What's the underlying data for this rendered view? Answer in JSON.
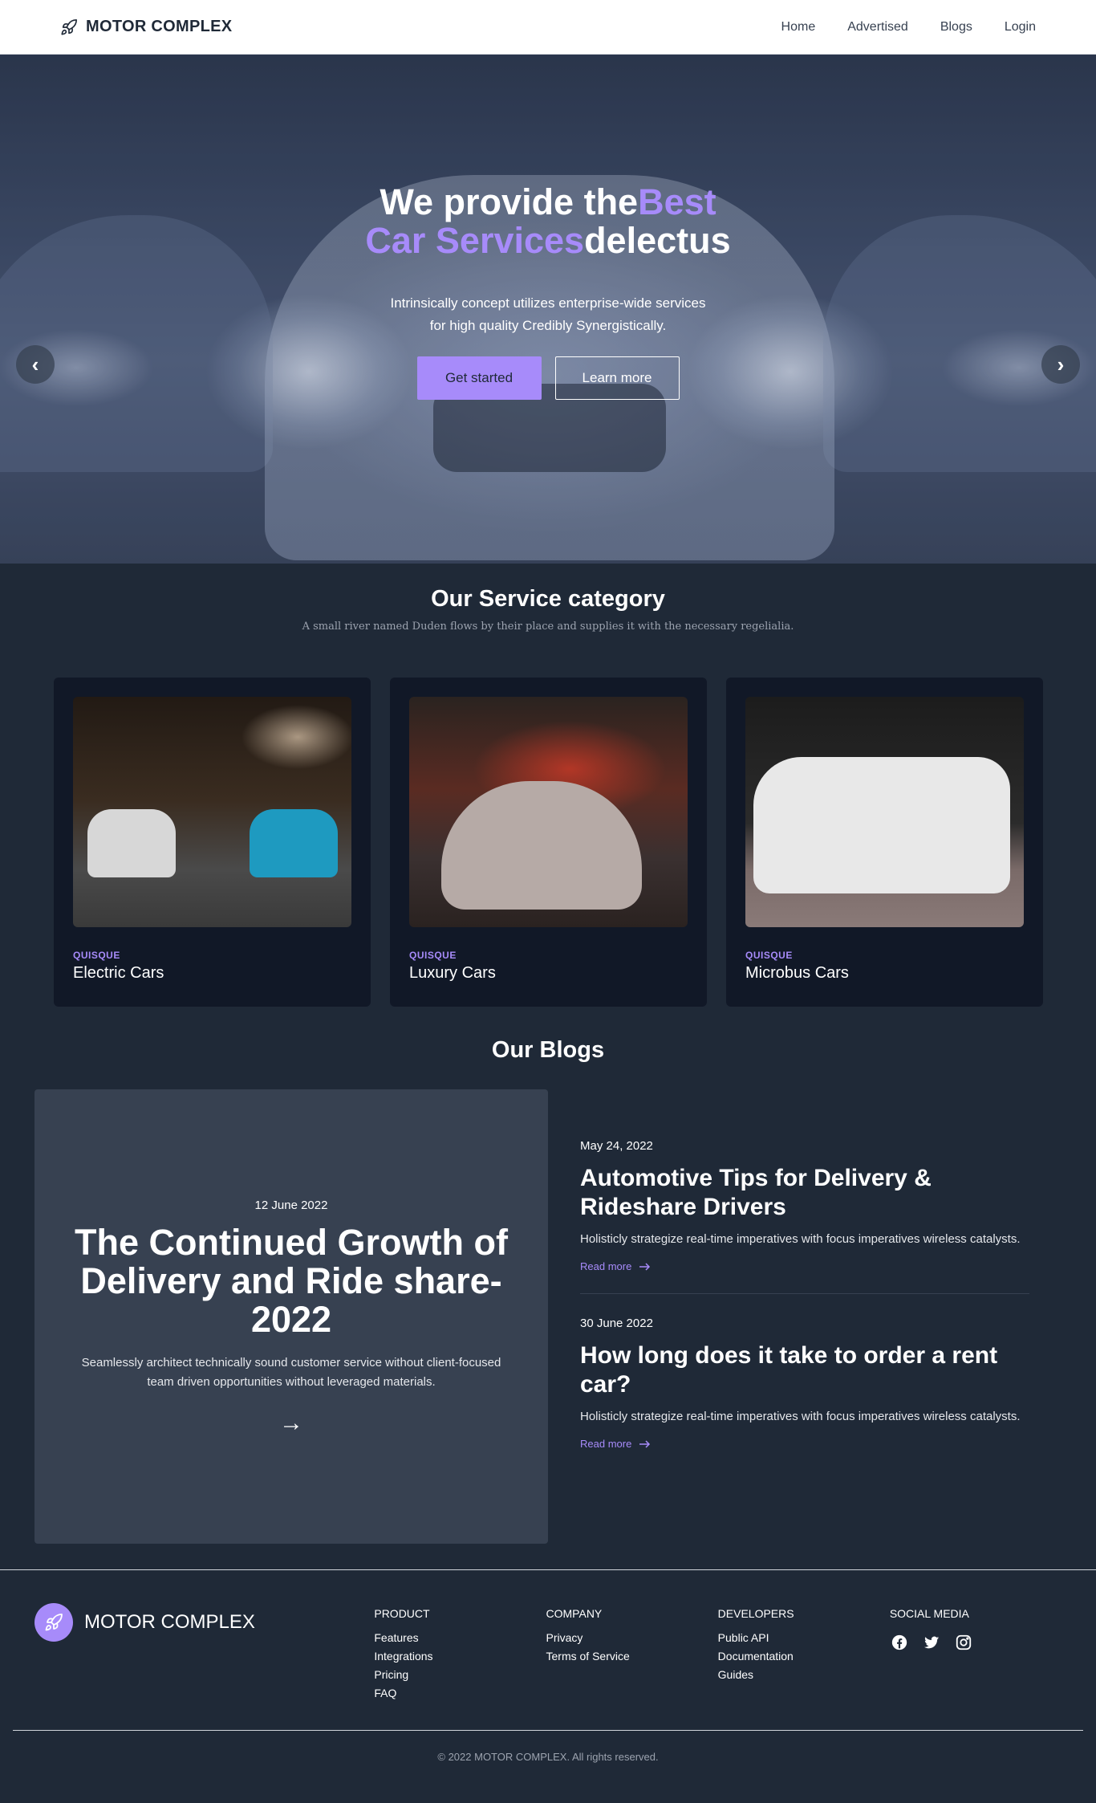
{
  "nav": {
    "brand": "MOTOR COMPLEX",
    "links": [
      "Home",
      "Advertised",
      "Blogs",
      "Login"
    ]
  },
  "hero": {
    "title_prefix": "We provide the",
    "title_accent": "Best Car Services",
    "title_suffix": "delectus",
    "description": "Intrinsically concept utilizes enterprise-wide services for high quality Credibly Synergistically.",
    "primary_button": "Get started",
    "secondary_button": "Learn more",
    "prev_label": "‹",
    "next_label": "›"
  },
  "service": {
    "title": "Our Service category",
    "subtitle": "A small river named Duden flows by their place and supplies it with the necessary regelialia.",
    "cards": [
      {
        "tag": "QUISQUE",
        "name": "Electric Cars"
      },
      {
        "tag": "QUISQUE",
        "name": "Luxury Cars"
      },
      {
        "tag": "QUISQUE",
        "name": "Microbus Cars"
      }
    ]
  },
  "blogs": {
    "title": "Our Blogs",
    "featured": {
      "date": "12 June 2022",
      "title": "The Continued Growth of Delivery and Ride share-2022",
      "description": "Seamlessly architect technically sound customer service without client-focused team driven opportunities without leveraged materials.",
      "arrow": "→"
    },
    "items": [
      {
        "date": "May 24, 2022",
        "title": "Automotive Tips for Delivery & Rideshare Drivers",
        "description": "Holisticly strategize real-time imperatives with focus imperatives wireless catalysts.",
        "link": "Read more"
      },
      {
        "date": "30 June 2022",
        "title": "How long does it take to order a rent car?",
        "description": "Holisticly strategize real-time imperatives with focus imperatives wireless catalysts.",
        "link": "Read more"
      }
    ]
  },
  "footer": {
    "brand": "MOTOR COMPLEX",
    "columns": [
      {
        "title": "PRODUCT",
        "links": [
          "Features",
          "Integrations",
          "Pricing",
          "FAQ"
        ]
      },
      {
        "title": "COMPANY",
        "links": [
          "Privacy",
          "Terms of Service"
        ]
      },
      {
        "title": "DEVELOPERS",
        "links": [
          "Public API",
          "Documentation",
          "Guides"
        ]
      }
    ],
    "social_title": "SOCIAL MEDIA",
    "social_icons": [
      "facebook-icon",
      "twitter-icon",
      "instagram-icon"
    ],
    "copyright": "© 2022 MOTOR COMPLEX. All rights reserved."
  },
  "colors": {
    "accent": "#a78bfa",
    "background": "#1f2937",
    "card": "#111827",
    "feature_card": "#374151"
  }
}
